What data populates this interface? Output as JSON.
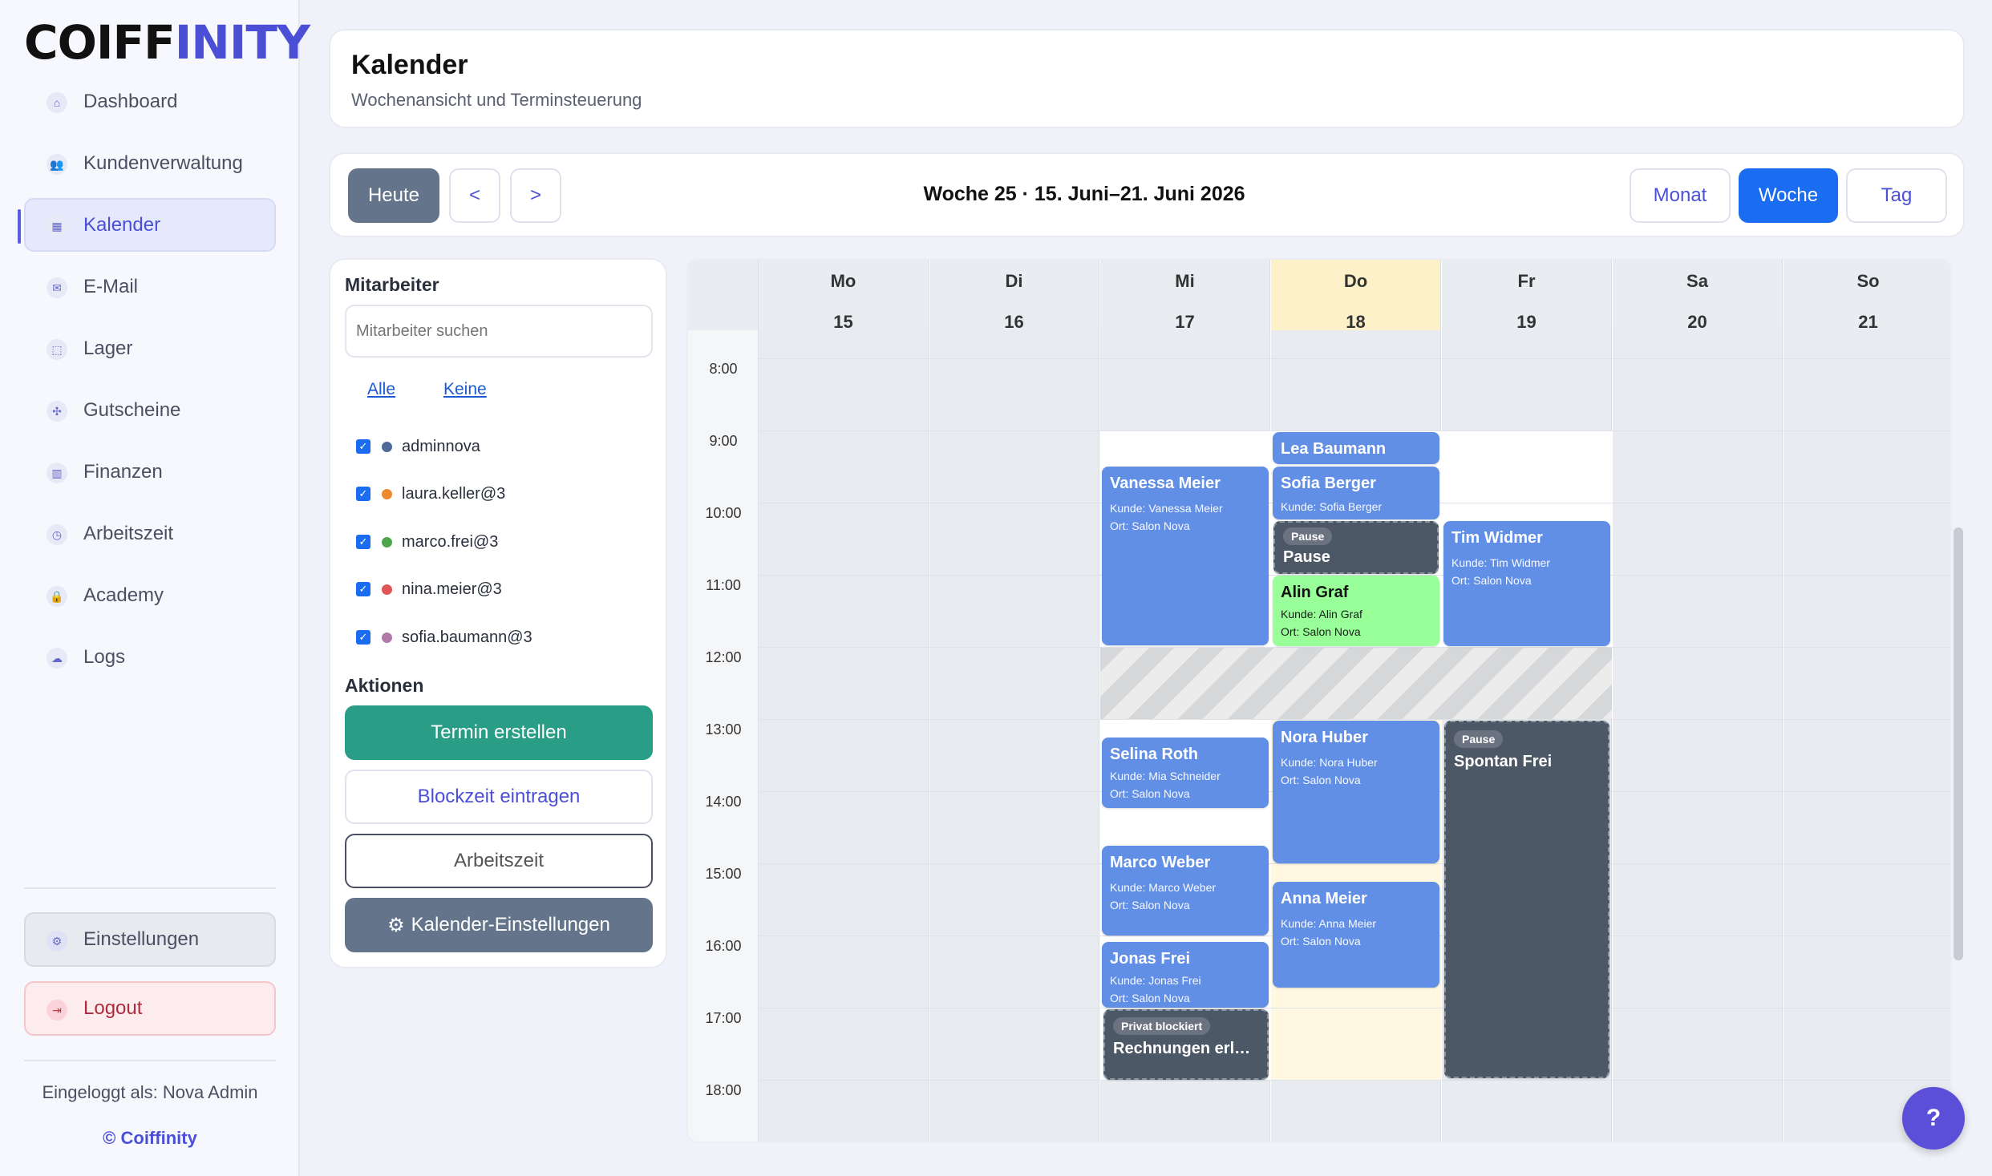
{
  "app": {
    "logo_a": "COIFF",
    "logo_b": "INITY"
  },
  "sidebar": {
    "items": [
      {
        "label": "Dashboard",
        "icon": "⌂"
      },
      {
        "label": "Kundenverwaltung",
        "icon": "👥"
      },
      {
        "label": "Kalender",
        "icon": "▦"
      },
      {
        "label": "E-Mail",
        "icon": "✉"
      },
      {
        "label": "Lager",
        "icon": "⬚"
      },
      {
        "label": "Gutscheine",
        "icon": "✣"
      },
      {
        "label": "Finanzen",
        "icon": "▥"
      },
      {
        "label": "Arbeitszeit",
        "icon": "◷"
      },
      {
        "label": "Academy",
        "icon": "🔒"
      },
      {
        "label": "Logs",
        "icon": "☁"
      }
    ],
    "settings": "Einstellungen",
    "logout": "Logout",
    "logged_in": "Eingeloggt als: Nova Admin",
    "copyright": "© Coiffinity"
  },
  "header": {
    "title": "Kalender",
    "subtitle": "Wochenansicht und Terminsteuerung"
  },
  "toolbar": {
    "today": "Heute",
    "prev": "<",
    "next": ">",
    "week": "Woche 25 · 15. Juni–21. Juni 2026",
    "month": "Monat",
    "woche": "Woche",
    "tag": "Tag"
  },
  "panel": {
    "employees_title": "Mitarbeiter",
    "search_placeholder": "Mitarbeiter suchen",
    "all": "Alle",
    "none": "Keine",
    "employees": [
      {
        "name": "adminnova",
        "color": "#4e6a96"
      },
      {
        "name": "laura.keller@3",
        "color": "#ee8a2e"
      },
      {
        "name": "marco.frei@3",
        "color": "#4ca64c"
      },
      {
        "name": "nina.meier@3",
        "color": "#e05555"
      },
      {
        "name": "sofia.baumann@3",
        "color": "#b07aa8"
      }
    ],
    "actions_title": "Aktionen",
    "create": "Termin erstellen",
    "block": "Blockzeit eintragen",
    "worktime": "Arbeitszeit",
    "cal_settings": "Kalender-Einstellungen"
  },
  "calendar": {
    "days": [
      {
        "name": "Mo",
        "num": "15"
      },
      {
        "name": "Di",
        "num": "16"
      },
      {
        "name": "Mi",
        "num": "17"
      },
      {
        "name": "Do",
        "num": "18"
      },
      {
        "name": "Fr",
        "num": "19"
      },
      {
        "name": "Sa",
        "num": "20"
      },
      {
        "name": "So",
        "num": "21"
      }
    ],
    "hours": [
      "8:00",
      "9:00",
      "10:00",
      "11:00",
      "12:00",
      "13:00",
      "14:00",
      "15:00",
      "16:00",
      "17:00",
      "18:00"
    ],
    "events": {
      "vanessa": {
        "title": "Vanessa Meier",
        "l1": "Kunde: Vanessa Meier",
        "l2": "Ort: Salon Nova"
      },
      "lea": {
        "title": "Lea Baumann"
      },
      "sofia": {
        "title": "Sofia Berger",
        "l1": "Kunde: Sofia Berger"
      },
      "pause1": {
        "tag": "Pause",
        "title": "Pause"
      },
      "alin": {
        "title": "Alin Graf",
        "l1": "Kunde: Alin Graf",
        "l2": "Ort: Salon Nova"
      },
      "tim": {
        "title": "Tim Widmer",
        "l1": "Kunde: Tim Widmer",
        "l2": "Ort: Salon Nova"
      },
      "selina": {
        "title": "Selina Roth",
        "l1": "Kunde: Mia Schneider",
        "l2": "Ort: Salon Nova"
      },
      "nora": {
        "title": "Nora Huber",
        "l1": "Kunde: Nora Huber",
        "l2": "Ort: Salon Nova"
      },
      "spontan": {
        "tag": "Pause",
        "title": "Spontan Frei"
      },
      "marco": {
        "title": "Marco Weber",
        "l1": "Kunde: Marco Weber",
        "l2": "Ort: Salon Nova"
      },
      "anna": {
        "title": "Anna Meier",
        "l1": "Kunde: Anna Meier",
        "l2": "Ort: Salon Nova"
      },
      "jonas": {
        "title": "Jonas Frei",
        "l1": "Kunde: Jonas Frei",
        "l2": "Ort: Salon Nova"
      },
      "privat": {
        "tag": "Privat blockiert",
        "title": "Rechnungen erle…"
      }
    }
  },
  "help": "?"
}
